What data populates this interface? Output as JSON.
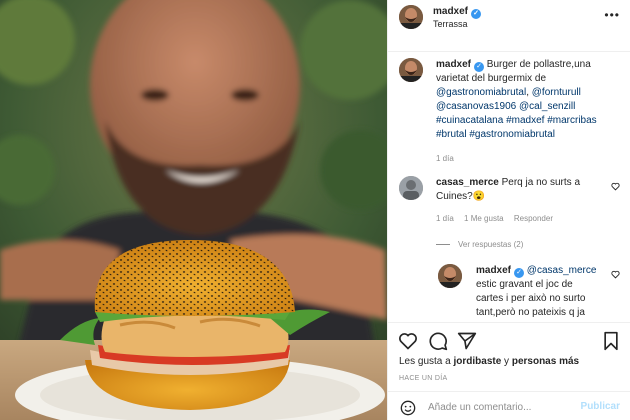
{
  "header": {
    "username": "madxef",
    "location": "Terrassa"
  },
  "caption": {
    "username": "madxef",
    "text_lines": [
      "Burger de pollastre,una",
      "varietat del burgermix de"
    ],
    "tags_lines": [
      [
        "@gastronomiabrutal",
        ", ",
        "@fornturull"
      ],
      [
        "@casanovas1906",
        " ",
        "@cal_senzill"
      ],
      [
        "#cuinacatalana",
        " ",
        "#madxef",
        " ",
        "#marcribas"
      ],
      [
        "#brutal",
        " ",
        "#gastronomiabrutal"
      ]
    ],
    "age": "1 día"
  },
  "comment": {
    "username": "casas_merce",
    "text": "Perq ja no surts a",
    "text_line2": "Cuines?",
    "emoji": "😮",
    "age": "1 día",
    "likes": "1 Me gusta",
    "reply_label": "Responder",
    "view_replies": "Ver respuestas (2)"
  },
  "reply": {
    "username": "madxef",
    "mention": "@casas_merce",
    "line2": "estic gravant el joc de",
    "line3": "cartes i per això no surto",
    "line4": "tant,però no pateixis q ja"
  },
  "actions": {
    "likes_prefix": "Les gusta a ",
    "likes_user": "jordibaste",
    "likes_mid": " y ",
    "likes_others": "personas más",
    "time_ago": "HACE UN DÍA",
    "comment_placeholder": "Añade un comentario...",
    "publish_label": "Publicar"
  },
  "colors": {
    "link": "#00376b",
    "verified": "#3897f0",
    "muted": "#8e8e8e",
    "publish": "#b2dffc"
  },
  "icons": [
    "more-icon",
    "verified-icon",
    "heart-icon",
    "comment-icon",
    "share-icon",
    "bookmark-icon",
    "emoji-icon"
  ]
}
